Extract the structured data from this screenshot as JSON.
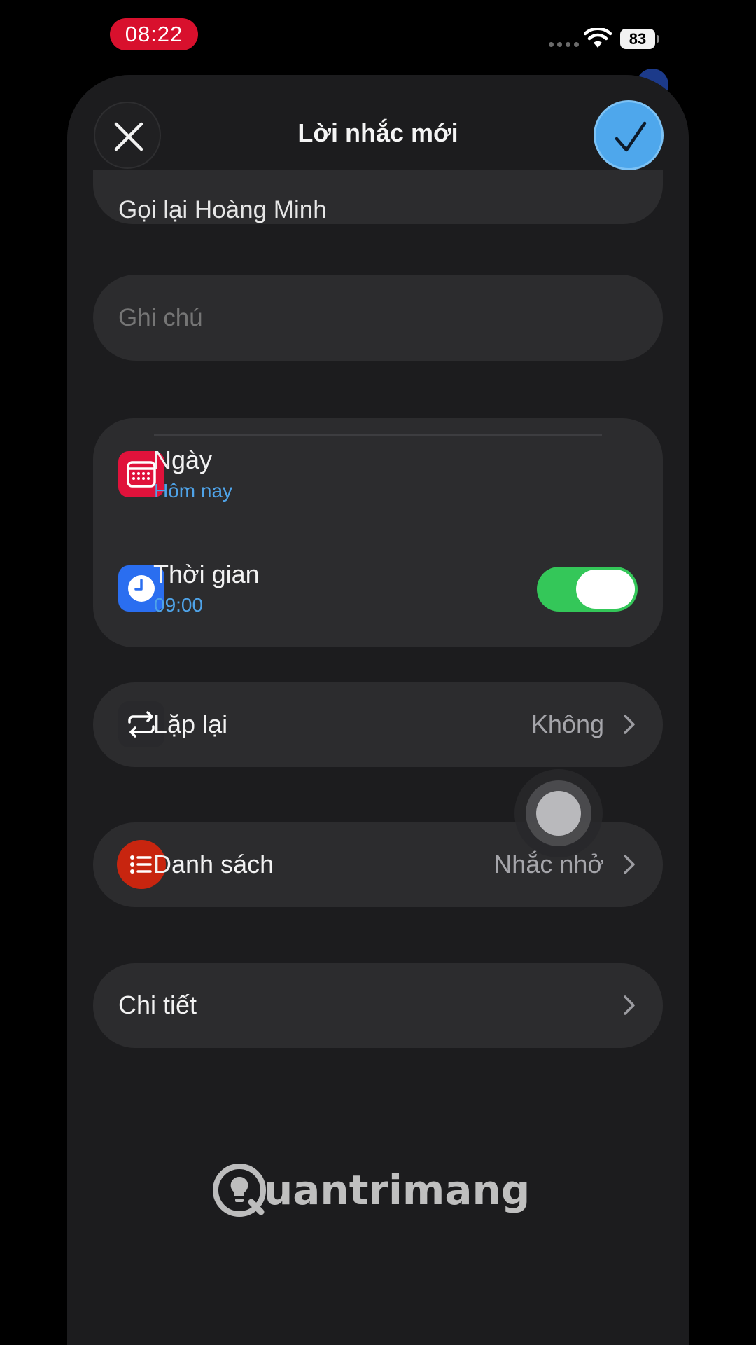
{
  "status_bar": {
    "time": "08:22",
    "battery": "83"
  },
  "sheet": {
    "title": "Lời nhắc mới",
    "reminder_title": "Gọi lại Hoàng Minh",
    "notes_placeholder": "Ghi chú"
  },
  "date_card": {
    "date_label": "Ngày",
    "date_value": "Hôm nay",
    "time_label": "Thời gian",
    "time_value": "09:00",
    "time_enabled": true
  },
  "repeat": {
    "label": "Lặp lại",
    "value": "Không"
  },
  "list": {
    "label": "Danh sách",
    "value": "Nhắc nhở"
  },
  "details": {
    "label": "Chi tiết"
  },
  "watermark": "uantrimang",
  "colors": {
    "accent_blue": "#4ea7ec",
    "calendar_red": "#e0123b",
    "clock_blue": "#2a6ef0",
    "list_red": "#c8250f",
    "toggle_green": "#34c759"
  },
  "icons": {
    "close": "close-icon",
    "done": "checkmark-icon",
    "date": "calendar-icon",
    "time": "clock-icon",
    "repeat": "repeat-icon",
    "list": "list-icon",
    "chevron": "chevron-right-icon"
  }
}
